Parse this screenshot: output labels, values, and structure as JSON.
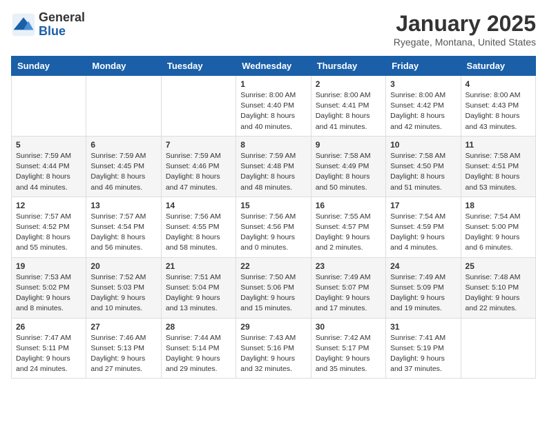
{
  "logo": {
    "general": "General",
    "blue": "Blue"
  },
  "title": "January 2025",
  "location": "Ryegate, Montana, United States",
  "weekdays": [
    "Sunday",
    "Monday",
    "Tuesday",
    "Wednesday",
    "Thursday",
    "Friday",
    "Saturday"
  ],
  "weeks": [
    [
      {
        "day": "",
        "info": ""
      },
      {
        "day": "",
        "info": ""
      },
      {
        "day": "",
        "info": ""
      },
      {
        "day": "1",
        "info": "Sunrise: 8:00 AM\nSunset: 4:40 PM\nDaylight: 8 hours\nand 40 minutes."
      },
      {
        "day": "2",
        "info": "Sunrise: 8:00 AM\nSunset: 4:41 PM\nDaylight: 8 hours\nand 41 minutes."
      },
      {
        "day": "3",
        "info": "Sunrise: 8:00 AM\nSunset: 4:42 PM\nDaylight: 8 hours\nand 42 minutes."
      },
      {
        "day": "4",
        "info": "Sunrise: 8:00 AM\nSunset: 4:43 PM\nDaylight: 8 hours\nand 43 minutes."
      }
    ],
    [
      {
        "day": "5",
        "info": "Sunrise: 7:59 AM\nSunset: 4:44 PM\nDaylight: 8 hours\nand 44 minutes."
      },
      {
        "day": "6",
        "info": "Sunrise: 7:59 AM\nSunset: 4:45 PM\nDaylight: 8 hours\nand 46 minutes."
      },
      {
        "day": "7",
        "info": "Sunrise: 7:59 AM\nSunset: 4:46 PM\nDaylight: 8 hours\nand 47 minutes."
      },
      {
        "day": "8",
        "info": "Sunrise: 7:59 AM\nSunset: 4:48 PM\nDaylight: 8 hours\nand 48 minutes."
      },
      {
        "day": "9",
        "info": "Sunrise: 7:58 AM\nSunset: 4:49 PM\nDaylight: 8 hours\nand 50 minutes."
      },
      {
        "day": "10",
        "info": "Sunrise: 7:58 AM\nSunset: 4:50 PM\nDaylight: 8 hours\nand 51 minutes."
      },
      {
        "day": "11",
        "info": "Sunrise: 7:58 AM\nSunset: 4:51 PM\nDaylight: 8 hours\nand 53 minutes."
      }
    ],
    [
      {
        "day": "12",
        "info": "Sunrise: 7:57 AM\nSunset: 4:52 PM\nDaylight: 8 hours\nand 55 minutes."
      },
      {
        "day": "13",
        "info": "Sunrise: 7:57 AM\nSunset: 4:54 PM\nDaylight: 8 hours\nand 56 minutes."
      },
      {
        "day": "14",
        "info": "Sunrise: 7:56 AM\nSunset: 4:55 PM\nDaylight: 8 hours\nand 58 minutes."
      },
      {
        "day": "15",
        "info": "Sunrise: 7:56 AM\nSunset: 4:56 PM\nDaylight: 9 hours\nand 0 minutes."
      },
      {
        "day": "16",
        "info": "Sunrise: 7:55 AM\nSunset: 4:57 PM\nDaylight: 9 hours\nand 2 minutes."
      },
      {
        "day": "17",
        "info": "Sunrise: 7:54 AM\nSunset: 4:59 PM\nDaylight: 9 hours\nand 4 minutes."
      },
      {
        "day": "18",
        "info": "Sunrise: 7:54 AM\nSunset: 5:00 PM\nDaylight: 9 hours\nand 6 minutes."
      }
    ],
    [
      {
        "day": "19",
        "info": "Sunrise: 7:53 AM\nSunset: 5:02 PM\nDaylight: 9 hours\nand 8 minutes."
      },
      {
        "day": "20",
        "info": "Sunrise: 7:52 AM\nSunset: 5:03 PM\nDaylight: 9 hours\nand 10 minutes."
      },
      {
        "day": "21",
        "info": "Sunrise: 7:51 AM\nSunset: 5:04 PM\nDaylight: 9 hours\nand 13 minutes."
      },
      {
        "day": "22",
        "info": "Sunrise: 7:50 AM\nSunset: 5:06 PM\nDaylight: 9 hours\nand 15 minutes."
      },
      {
        "day": "23",
        "info": "Sunrise: 7:49 AM\nSunset: 5:07 PM\nDaylight: 9 hours\nand 17 minutes."
      },
      {
        "day": "24",
        "info": "Sunrise: 7:49 AM\nSunset: 5:09 PM\nDaylight: 9 hours\nand 19 minutes."
      },
      {
        "day": "25",
        "info": "Sunrise: 7:48 AM\nSunset: 5:10 PM\nDaylight: 9 hours\nand 22 minutes."
      }
    ],
    [
      {
        "day": "26",
        "info": "Sunrise: 7:47 AM\nSunset: 5:11 PM\nDaylight: 9 hours\nand 24 minutes."
      },
      {
        "day": "27",
        "info": "Sunrise: 7:46 AM\nSunset: 5:13 PM\nDaylight: 9 hours\nand 27 minutes."
      },
      {
        "day": "28",
        "info": "Sunrise: 7:44 AM\nSunset: 5:14 PM\nDaylight: 9 hours\nand 29 minutes."
      },
      {
        "day": "29",
        "info": "Sunrise: 7:43 AM\nSunset: 5:16 PM\nDaylight: 9 hours\nand 32 minutes."
      },
      {
        "day": "30",
        "info": "Sunrise: 7:42 AM\nSunset: 5:17 PM\nDaylight: 9 hours\nand 35 minutes."
      },
      {
        "day": "31",
        "info": "Sunrise: 7:41 AM\nSunset: 5:19 PM\nDaylight: 9 hours\nand 37 minutes."
      },
      {
        "day": "",
        "info": ""
      }
    ]
  ]
}
